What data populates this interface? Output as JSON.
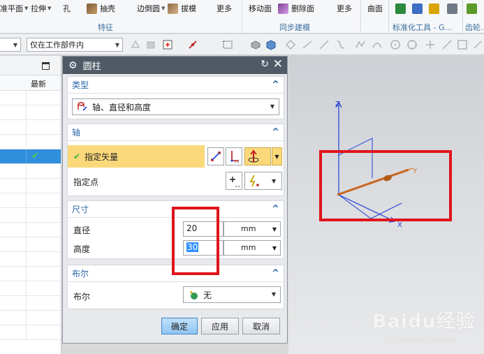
{
  "ribbon": {
    "buttons": {
      "datum_plane": "准平面",
      "extrude": "拉伸",
      "hole": "孔",
      "shell": "抽壳",
      "edge_blend": "边倒圆",
      "draft": "拔模",
      "more_1": "更多",
      "move_face": "移动面",
      "delete_face": "删除面",
      "more_2": "更多",
      "surface": "曲面"
    },
    "groups": {
      "feature": "特征",
      "sync_modeling": "同步建模",
      "standard_tools": "标准化工具 - G...",
      "gear": "齿轮..."
    }
  },
  "toolbar": {
    "filter_value": "",
    "scope_value": "仅在工作部件内"
  },
  "navigator": {
    "latest_header": "最新",
    "rows": [
      {
        "selected": false,
        "check": ""
      },
      {
        "selected": false,
        "check": ""
      },
      {
        "selected": false,
        "check": ""
      },
      {
        "selected": false,
        "check": ""
      },
      {
        "selected": true,
        "check": "✔"
      },
      {
        "selected": false,
        "check": ""
      },
      {
        "selected": false,
        "check": ""
      },
      {
        "selected": false,
        "check": ""
      },
      {
        "selected": false,
        "check": ""
      },
      {
        "selected": false,
        "check": ""
      },
      {
        "selected": false,
        "check": ""
      },
      {
        "selected": false,
        "check": ""
      },
      {
        "selected": false,
        "check": ""
      },
      {
        "selected": false,
        "check": ""
      },
      {
        "selected": false,
        "check": ""
      },
      {
        "selected": false,
        "check": ""
      },
      {
        "selected": false,
        "check": ""
      }
    ]
  },
  "dialog": {
    "title": "圆柱",
    "type_section": {
      "title": "类型",
      "value": "轴、直径和高度"
    },
    "axis_section": {
      "title": "轴",
      "specify_vector": "指定矢量",
      "specify_point": "指定点"
    },
    "dimension_section": {
      "title": "尺寸",
      "diameter_label": "直径",
      "diameter_value": "20",
      "diameter_unit": "mm",
      "height_label": "高度",
      "height_value": "30",
      "height_unit": "mm"
    },
    "boolean_section": {
      "title": "布尔",
      "label": "布尔",
      "value": "无"
    },
    "buttons": {
      "ok": "确定",
      "apply": "应用",
      "cancel": "取消"
    }
  },
  "viewport": {
    "axis_labels": {
      "z": "Z",
      "y": "Y",
      "x": "X"
    },
    "watermark_logo": "Baidu经验",
    "watermark_url": "jingyan.baidu.com"
  },
  "colors": {
    "highlight_frame": "#e0141c",
    "selected_row": "#2f8fdc",
    "vector_row": "#fbd97a",
    "section_title": "#2a66a8",
    "titlebar": "#4f5a66",
    "wcs_blue": "#1f3fd8",
    "vector_orange": "#c8641a"
  }
}
